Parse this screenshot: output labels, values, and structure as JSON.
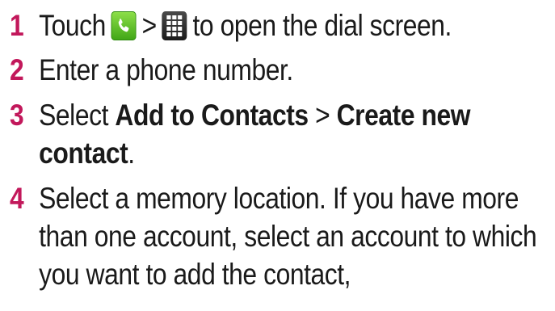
{
  "steps": [
    {
      "number": "1",
      "text_a": "Touch",
      "sep": ">",
      "text_b": "to open the dial screen.",
      "icons": [
        "phone-icon",
        "dialpad-icon"
      ],
      "icon_colors": {
        "phone": "#5cc22a",
        "dialpad": "#2a2a2a"
      }
    },
    {
      "number": "2",
      "text": "Enter a phone number."
    },
    {
      "number": "3",
      "text_a": "Select ",
      "bold_a": "Add to Contacts",
      "sep": " > ",
      "bold_b": "Create new contact",
      "text_end": "."
    },
    {
      "number": "4",
      "text": "Select a memory location. If you have more than one account, select an account to which you want to add the contact,"
    }
  ],
  "accent_color": "#c2185b"
}
